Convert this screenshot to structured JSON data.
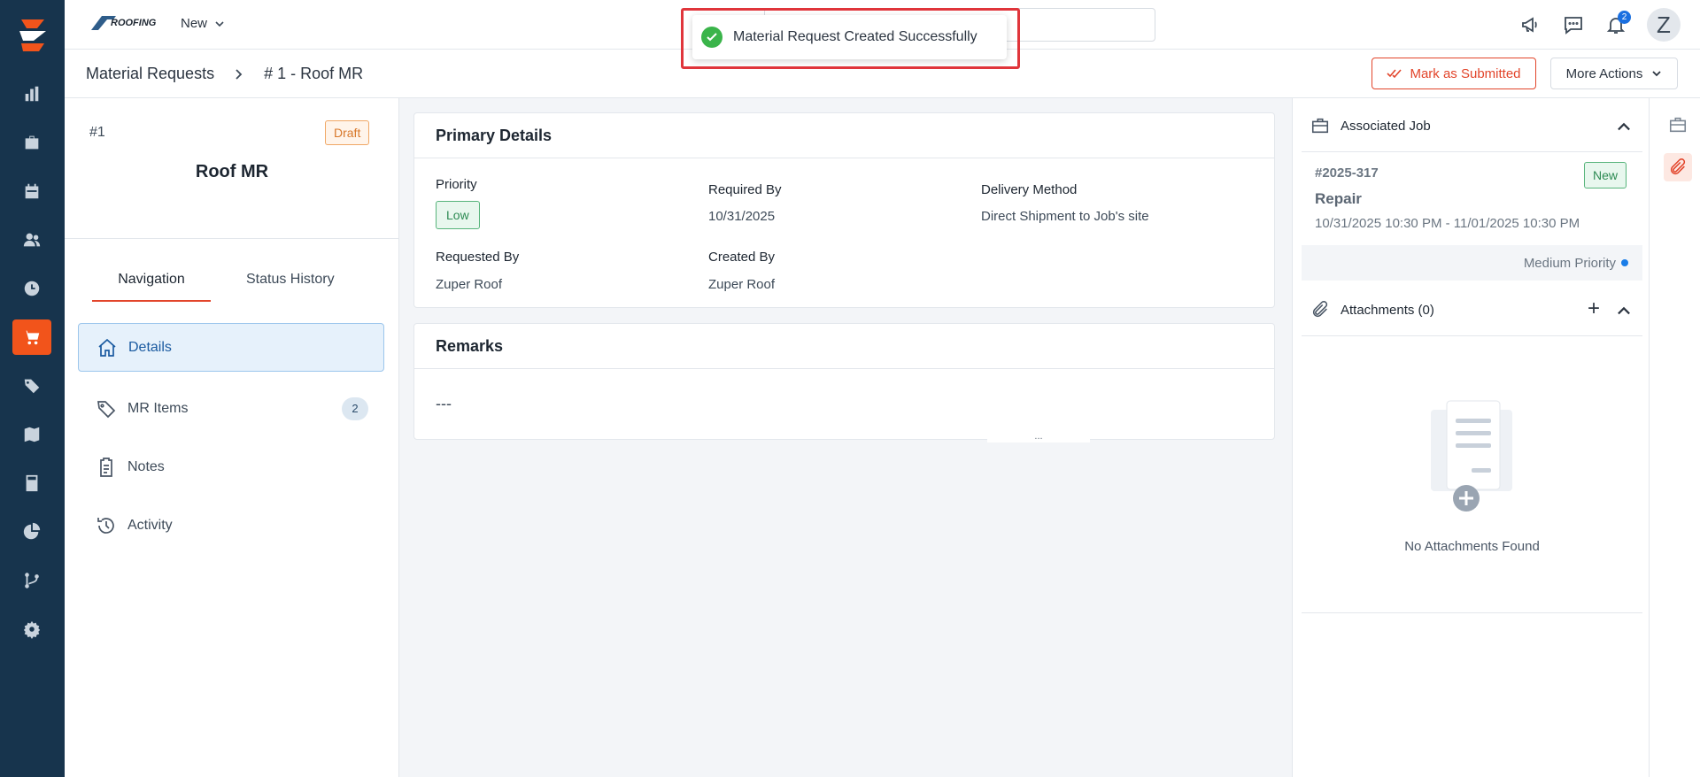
{
  "app": {
    "brand": "ROOFING",
    "new_label": "New"
  },
  "toast": {
    "message": "Material Request Created Successfully"
  },
  "notifications": {
    "count": "2"
  },
  "user": {
    "initial": "Z"
  },
  "breadcrumb": {
    "parent": "Material Requests",
    "current": "# 1 - Roof MR"
  },
  "actions": {
    "submit_label": "Mark as Submitted",
    "more_label": "More Actions"
  },
  "record": {
    "number": "#1",
    "status": "Draft",
    "title": "Roof MR"
  },
  "tabs": {
    "navigation": "Navigation",
    "status_history": "Status History"
  },
  "nav": {
    "details": "Details",
    "mr_items": "MR Items",
    "mr_items_count": "2",
    "notes": "Notes",
    "activity": "Activity"
  },
  "primary": {
    "title": "Primary Details",
    "priority_label": "Priority",
    "priority_value": "Low",
    "required_by_label": "Required By",
    "required_by_value": "10/31/2025",
    "delivery_label": "Delivery Method",
    "delivery_value": "Direct Shipment to Job's site",
    "requested_by_label": "Requested By",
    "requested_by_value": "Zuper Roof",
    "created_by_label": "Created By",
    "created_by_value": "Zuper Roof"
  },
  "remarks": {
    "title": "Remarks",
    "value": "---"
  },
  "job": {
    "section_title": "Associated Job",
    "number": "#2025-317",
    "status": "New",
    "name": "Repair",
    "dates": "10/31/2025 10:30 PM - 11/01/2025 10:30 PM",
    "priority": "Medium Priority"
  },
  "attachments": {
    "section_title": "Attachments (0)",
    "empty_text": "No Attachments Found"
  },
  "colors": {
    "rail": "#17344d",
    "accent": "#f2541b",
    "success": "#3ab44a",
    "highlight_frame": "#e0353b"
  }
}
